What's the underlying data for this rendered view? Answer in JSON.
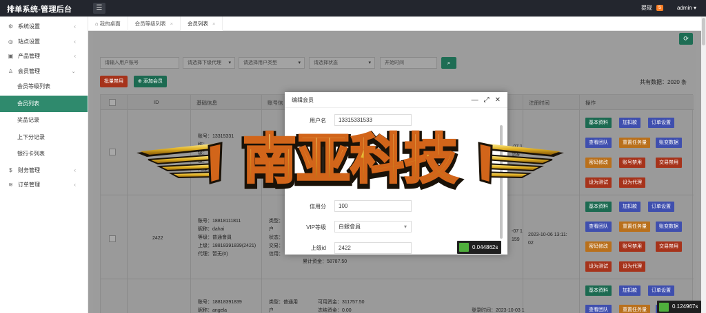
{
  "app": {
    "title": "排单系统-管理后台",
    "menu_icon": "menu-icon"
  },
  "topbar": {
    "withdraw_label": "提现",
    "withdraw_count": "5",
    "user": "admin"
  },
  "sidebar": {
    "items": [
      {
        "label": "系统设置",
        "icon": "gear-icon"
      },
      {
        "label": "站点设置",
        "icon": "globe-icon"
      },
      {
        "label": "产品管理",
        "icon": "box-icon"
      },
      {
        "label": "会员管理",
        "icon": "user-icon"
      }
    ],
    "sub_items": [
      {
        "label": "会员等级列表",
        "active": false
      },
      {
        "label": "会员列表",
        "active": true
      },
      {
        "label": "奖品记录",
        "active": false
      },
      {
        "label": "上下分记录",
        "active": false
      },
      {
        "label": "银行卡列表",
        "active": false
      }
    ],
    "bottom_items": [
      {
        "label": "财务管理",
        "icon": "dollar-icon"
      },
      {
        "label": "订单管理",
        "icon": "stack-icon"
      }
    ]
  },
  "tabs": [
    {
      "label": "我的桌面"
    },
    {
      "label": "会员等级列表",
      "close": "×"
    },
    {
      "label": "会员列表",
      "close": "×"
    }
  ],
  "filters": {
    "username_placeholder": "请输入用户账号",
    "agent_placeholder": "请选择下级代理",
    "type_placeholder": "请选择用户类型",
    "status_placeholder": "请选择状态",
    "start_time_placeholder": "开始时间"
  },
  "actions": {
    "batch_ban": "批量禁用",
    "add_member": "添加会员"
  },
  "total": "共有数据：2020 条",
  "table": {
    "headers": [
      "ID",
      "基础信息",
      "账号信",
      "注册时间",
      "操作"
    ],
    "rows": [
      {
        "id": "",
        "info": [
          "账号：13315331",
          "称：",
          "级：",
          "级：1811",
          "代理：0)"
        ],
        "col3": [],
        "reg_time": [
          "-07 1",
          "159"
        ]
      },
      {
        "id": "2422",
        "info": [
          "账号：18818111811",
          "昵称：dahai",
          "等级：普通會員",
          "上级：18818391839(2421)",
          "代理：暂无(0)"
        ],
        "col3": [
          "类型：",
          "户",
          "状态：",
          "交易：",
          "信用："
        ],
        "extra": "累计资金：58787.50",
        "reg_time": [
          "-07 1",
          "159"
        ],
        "time": [
          "2023-10-06 13:11:",
          "02"
        ]
      },
      {
        "id": "",
        "info": [
          "账号：18818391839",
          "昵称：angela"
        ],
        "col3": [
          "类型：普通用",
          "户"
        ],
        "extra": [
          "可用资金：311757.50",
          "冻结资金：0.00"
        ],
        "time": "登录时间：2023-10-03 1"
      }
    ],
    "row_buttons": [
      [
        "基本资料",
        "加扣款",
        "订单设置"
      ],
      [
        "查看团队",
        "重置任务量",
        "账变数据"
      ],
      [
        "密码修改",
        "账号禁用",
        "交易禁用"
      ],
      [
        "设为测试",
        "设为代理"
      ]
    ]
  },
  "modal": {
    "title": "编辑会员",
    "fields": [
      {
        "label": "用户名",
        "value": "13315331533"
      },
      {
        "label": "信用分",
        "value": "100"
      },
      {
        "label": "VIP等级",
        "value": "白銀會員"
      },
      {
        "label": "上级id",
        "value": "2422"
      }
    ],
    "timing": "0.044862s"
  },
  "footer_timing": "0.124967s",
  "watermark": "南亚科技",
  "colors": {
    "green": "#2f8a6d",
    "orange": "#ff7f25",
    "blue": "#3f4fae"
  }
}
